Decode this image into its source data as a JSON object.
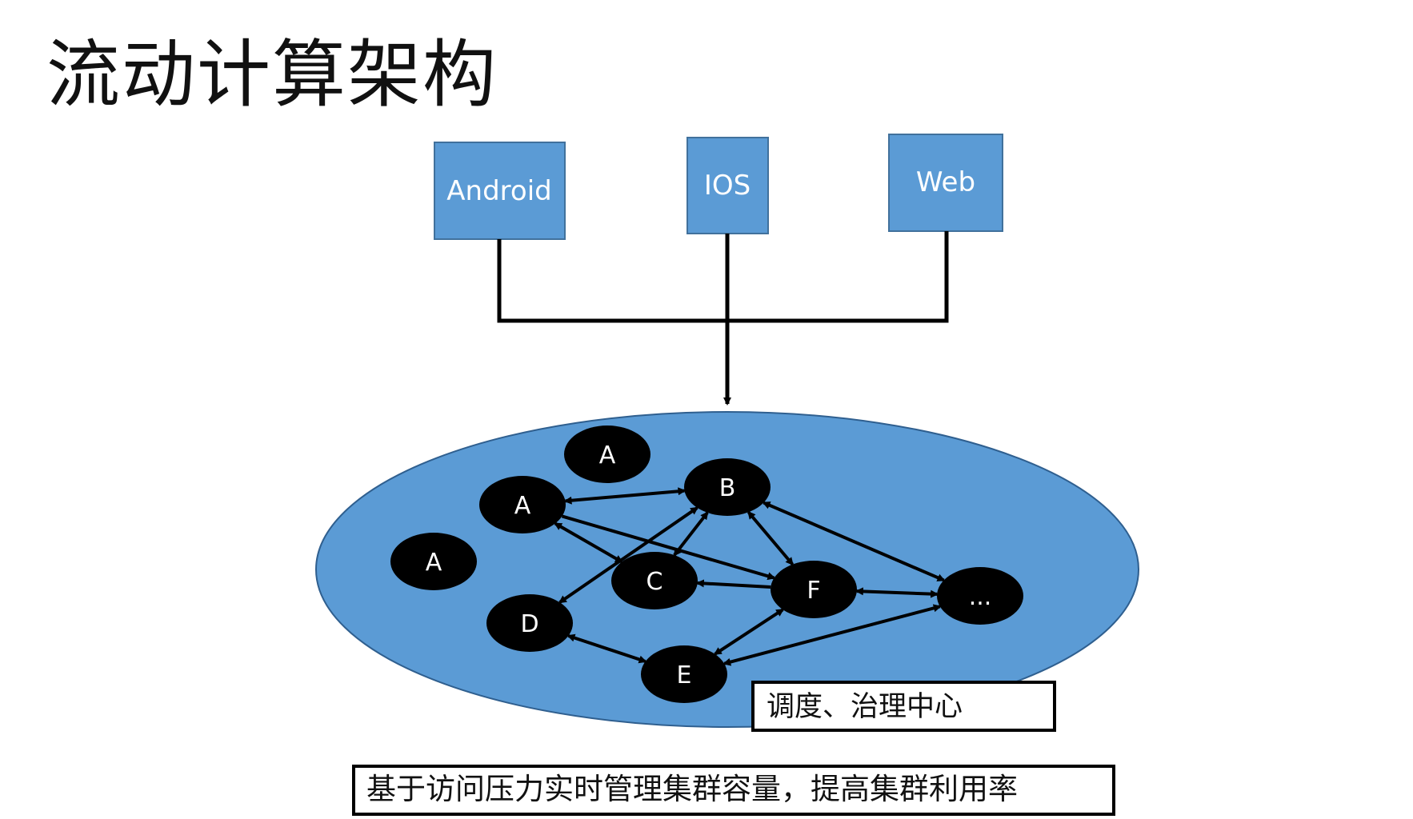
{
  "title": "流动计算架构",
  "clients": [
    {
      "id": "android",
      "label": "Android"
    },
    {
      "id": "ios",
      "label": "IOS"
    },
    {
      "id": "web",
      "label": "Web"
    }
  ],
  "nodes": [
    {
      "id": "a1",
      "label": "A"
    },
    {
      "id": "a2",
      "label": "A"
    },
    {
      "id": "a3",
      "label": "A"
    },
    {
      "id": "b",
      "label": "B"
    },
    {
      "id": "c",
      "label": "C"
    },
    {
      "id": "d",
      "label": "D"
    },
    {
      "id": "e",
      "label": "E"
    },
    {
      "id": "f",
      "label": "F"
    },
    {
      "id": "more",
      "label": "..."
    }
  ],
  "edges": [
    {
      "from": "a2",
      "to": "b",
      "type": "both"
    },
    {
      "from": "a2",
      "to": "c",
      "type": "both"
    },
    {
      "from": "a2",
      "to": "f",
      "type": "forward"
    },
    {
      "from": "b",
      "to": "c",
      "type": "both"
    },
    {
      "from": "b",
      "to": "d",
      "type": "both"
    },
    {
      "from": "b",
      "to": "f",
      "type": "both"
    },
    {
      "from": "b",
      "to": "more",
      "type": "both"
    },
    {
      "from": "f",
      "to": "c",
      "type": "forward"
    },
    {
      "from": "f",
      "to": "more",
      "type": "both"
    },
    {
      "from": "f",
      "to": "e",
      "type": "both"
    },
    {
      "from": "d",
      "to": "e",
      "type": "both"
    },
    {
      "from": "more",
      "to": "e",
      "type": "both"
    }
  ],
  "center_label": "调度、治理中心",
  "bottom_note": "基于访问压力实时管理集群容量，提高集群利用率",
  "colors": {
    "box_fill": "#5b9bd5",
    "box_stroke": "#41719c",
    "pool_fill": "#5b9bd5",
    "pool_stroke": "#2f5f8f",
    "node_fill": "#000000",
    "line": "#000000"
  }
}
